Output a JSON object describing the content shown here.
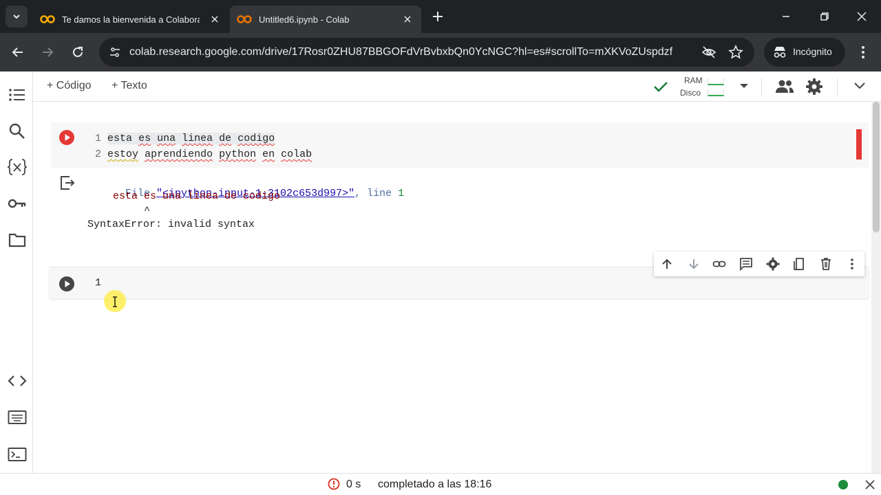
{
  "browser": {
    "tabs": [
      {
        "title": "Te damos la bienvenida a Colabora"
      },
      {
        "title": "Untitled6.ipynb - Colab"
      }
    ],
    "url": "colab.research.google.com/drive/17Rosr0ZHU87BBGOFdVrBvbxbQn0YcNGC?hl=es#scrollTo=mXKVoZUspdzf",
    "incognito_label": "Incógnito"
  },
  "colab": {
    "add_code_label": "+ Código",
    "add_text_label": "+ Texto",
    "ram_label": "RAM",
    "disk_label": "Disco"
  },
  "cells": [
    {
      "line_numbers": [
        "1",
        "2"
      ],
      "lines": [
        [
          "esta",
          " ",
          "es",
          " ",
          "una",
          " ",
          "linea",
          " ",
          "de",
          " ",
          "codigo"
        ],
        [
          "estoy",
          " ",
          "aprendiendo",
          " ",
          "python",
          " ",
          "en",
          " ",
          "colab"
        ]
      ],
      "output": {
        "file_prefix": "File ",
        "file_link": "\"<ipython-input-1-3102c653d997>\"",
        "line_text": ", line ",
        "line_num": "1",
        "code_line": "esta es una linea de codigo",
        "caret": "^",
        "error": "SyntaxError: invalid syntax"
      }
    },
    {
      "line_numbers": [
        "1"
      ]
    }
  ],
  "status": {
    "time": "0 s",
    "completed": "completado a las 18:16"
  },
  "colors": {
    "accent_red": "#e53935",
    "run_dark": "#444746",
    "check_green": "#188038",
    "link_blue": "#1a0dab",
    "status_green": "#1e8e3e"
  }
}
